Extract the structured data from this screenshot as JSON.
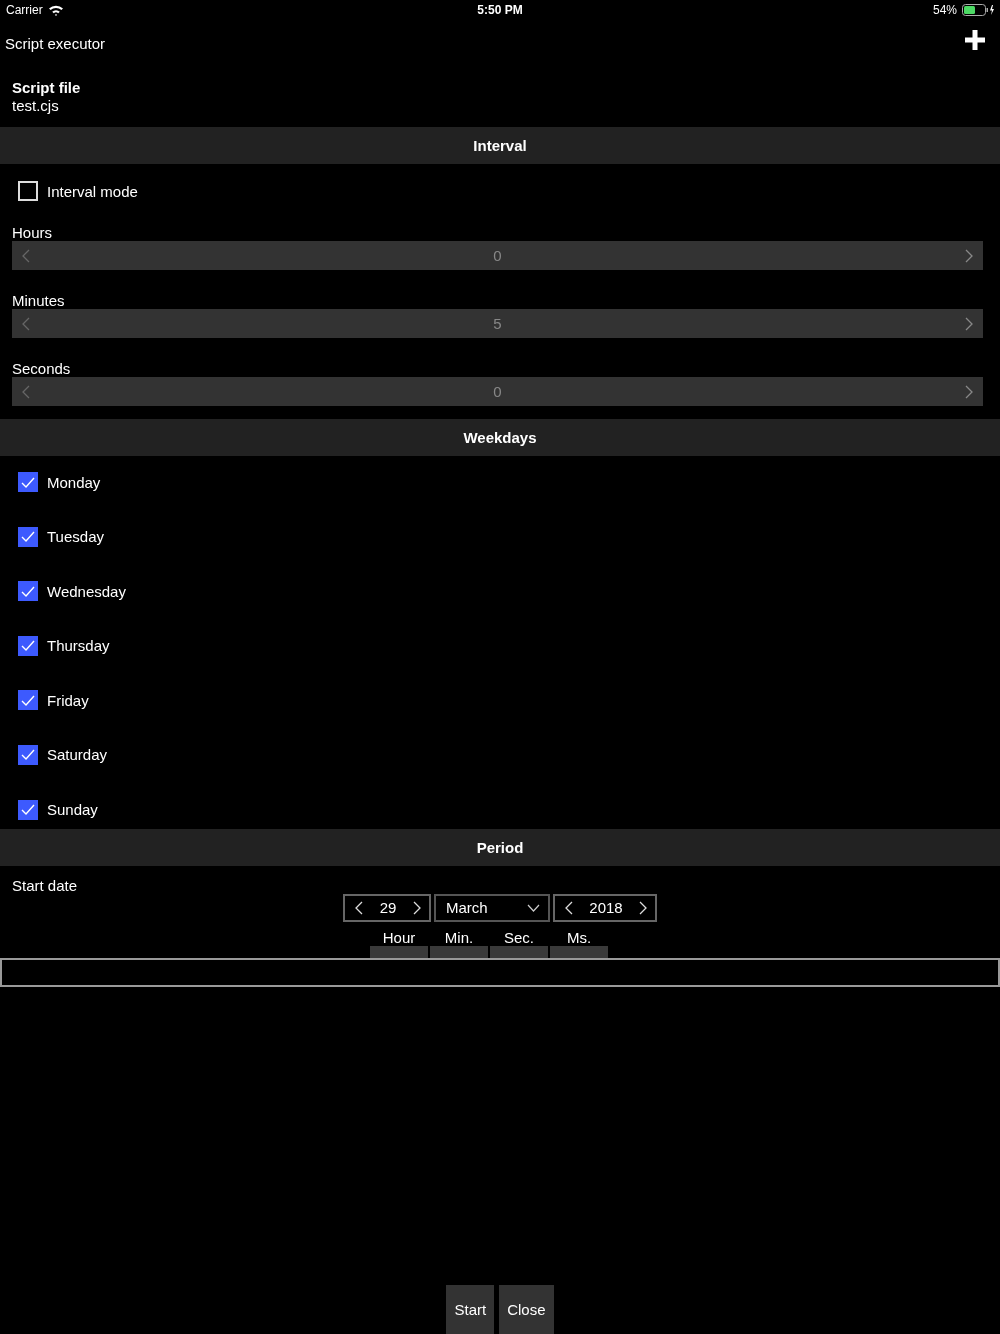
{
  "status_bar": {
    "carrier": "Carrier",
    "time": "5:50 PM",
    "battery": "54%"
  },
  "header": {
    "title": "Script executor"
  },
  "script_file": {
    "label": "Script file",
    "value": "test.cjs"
  },
  "sections": [
    {
      "kind": "interval",
      "title": "Interval",
      "interval_mode": {
        "label": "Interval mode",
        "checked": false
      },
      "steppers": [
        {
          "label": "Hours",
          "value": "0"
        },
        {
          "label": "Minutes",
          "value": "5"
        },
        {
          "label": "Seconds",
          "value": "0"
        }
      ]
    },
    {
      "kind": "weekdays",
      "title": "Weekdays",
      "days": [
        {
          "label": "Monday",
          "checked": true
        },
        {
          "label": "Tuesday",
          "checked": true
        },
        {
          "label": "Wednesday",
          "checked": true
        },
        {
          "label": "Thursday",
          "checked": true
        },
        {
          "label": "Friday",
          "checked": true
        },
        {
          "label": "Saturday",
          "checked": true
        },
        {
          "label": "Sunday",
          "checked": true
        }
      ]
    },
    {
      "kind": "period",
      "title": "Period",
      "start_date": {
        "label": "Start date",
        "day": "29",
        "month": "March",
        "year": "2018",
        "time_fields": [
          {
            "label": "Hour"
          },
          {
            "label": "Min."
          },
          {
            "label": "Sec."
          },
          {
            "label": "Ms."
          }
        ]
      }
    }
  ],
  "buttons": [
    {
      "label": "Start"
    },
    {
      "label": "Close"
    }
  ]
}
